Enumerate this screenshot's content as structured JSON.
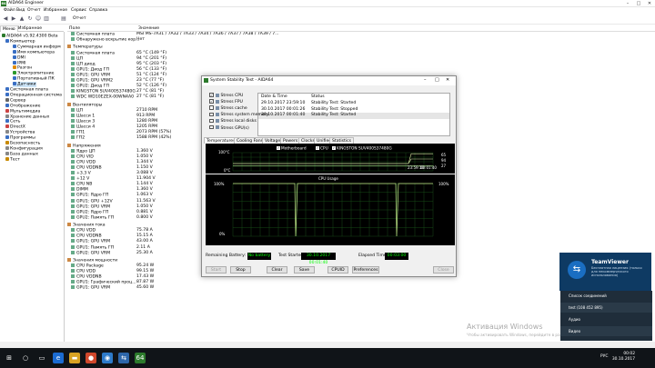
{
  "window": {
    "title": "AIDA64 Engineer",
    "icon_label": "64"
  },
  "menu": [
    "Файл",
    "Вид",
    "Отчет",
    "Избранное",
    "Сервис",
    "Справка"
  ],
  "toolbar": {
    "report_label": "Отчет"
  },
  "left_tabs": [
    "Меню",
    "Избранное"
  ],
  "tree": [
    {
      "label": "AIDA64 v5.92.4300 Beta",
      "indent": 0,
      "color": "#2c7a2c"
    },
    {
      "label": "Компьютер",
      "indent": 1,
      "color": "#3a6fc4"
    },
    {
      "label": "Суммарная информ",
      "indent": 3,
      "color": "#3a6fc4"
    },
    {
      "label": "Имя компьютера",
      "indent": 3,
      "color": "#3a6fc4"
    },
    {
      "label": "DMI",
      "indent": 3,
      "color": "#3a6fc4"
    },
    {
      "label": "IPMI",
      "indent": 3,
      "color": "#3a6fc4"
    },
    {
      "label": "Разгон",
      "indent": 3,
      "color": "#e08a00"
    },
    {
      "label": "Электропитание",
      "indent": 3,
      "color": "#2c9a2c"
    },
    {
      "label": "Портативный ПК",
      "indent": 3,
      "color": "#3a6fc4"
    },
    {
      "label": "Датчики",
      "indent": 3,
      "color": "#3a6fc4",
      "selected": true
    },
    {
      "label": "Системная плата",
      "indent": 1,
      "color": "#3a6fc4"
    },
    {
      "label": "Операционная система",
      "indent": 1,
      "color": "#3a6fc4"
    },
    {
      "label": "Сервер",
      "indent": 1,
      "color": "#666"
    },
    {
      "label": "Отображение",
      "indent": 1,
      "color": "#3a6fc4"
    },
    {
      "label": "Мультимедиа",
      "indent": 1,
      "color": "#c44"
    },
    {
      "label": "Хранение данных",
      "indent": 1,
      "color": "#888"
    },
    {
      "label": "Сеть",
      "indent": 1,
      "color": "#3a6fc4"
    },
    {
      "label": "DirectX",
      "indent": 1,
      "color": "#c44"
    },
    {
      "label": "Устройства",
      "indent": 1,
      "color": "#888"
    },
    {
      "label": "Программы",
      "indent": 1,
      "color": "#3a6fc4"
    },
    {
      "label": "Безопасность",
      "indent": 1,
      "color": "#c88a00"
    },
    {
      "label": "Конфигурация",
      "indent": 1,
      "color": "#888"
    },
    {
      "label": "База данных",
      "indent": 1,
      "color": "#888"
    },
    {
      "label": "Тест",
      "indent": 1,
      "color": "#c88a00"
    }
  ],
  "list_header": {
    "field": "Поле",
    "value": "Значение"
  },
  "list_rows": [
    {
      "type": "item",
      "field": "Системная плата",
      "value": "MSI MS-7A31 / 7A32 / 7A33 / 7A34 / 7A36 / 7A37 / 7A38 / 7A39 / 7..."
    },
    {
      "type": "item",
      "field": "Обнаружено вскрытие кор...",
      "value": "Нет"
    },
    {
      "type": "blank"
    },
    {
      "type": "group",
      "field": "Температуры"
    },
    {
      "type": "item",
      "field": "Системная плата",
      "value": "65 °C  (149 °F)"
    },
    {
      "type": "item",
      "field": "ЦП",
      "value": "94 °C  (201 °F)"
    },
    {
      "type": "item",
      "field": "ЦП диод",
      "value": "95 °C  (203 °F)"
    },
    {
      "type": "item",
      "field": "GPU1: Диод ГП",
      "value": "56 °C  (133 °F)"
    },
    {
      "type": "item",
      "field": "GPU1: GPU VRM",
      "value": "51 °C  (124 °F)"
    },
    {
      "type": "item",
      "field": "GPU1: GPU VRM2",
      "value": "23 °C  (77 °F)"
    },
    {
      "type": "item",
      "field": "GPU2: Диод ГП",
      "value": "52 °C  (126 °F)"
    },
    {
      "type": "item",
      "field": "KINGSTON SUV400S37480G",
      "value": "27 °C  (81 °F)"
    },
    {
      "type": "item",
      "field": "WDC WD10EZEX-00WN4A0",
      "value": "27 °C  (81 °F)"
    },
    {
      "type": "blank"
    },
    {
      "type": "group",
      "field": "Вентиляторы"
    },
    {
      "type": "item",
      "field": "ЦП",
      "value": "2710 RPM"
    },
    {
      "type": "item",
      "field": "Шасси 1",
      "value": "913 RPM"
    },
    {
      "type": "item",
      "field": "Шасси 3",
      "value": "1280 RPM"
    },
    {
      "type": "item",
      "field": "Шасси 4",
      "value": "1205 RPM"
    },
    {
      "type": "item",
      "field": "ГП1",
      "value": "2073 RPM  (57%)"
    },
    {
      "type": "item",
      "field": "ГП2",
      "value": "1588 RPM  (42%)"
    },
    {
      "type": "blank"
    },
    {
      "type": "group",
      "field": "Напряжения"
    },
    {
      "type": "item",
      "field": "Ядро ЦП",
      "value": "1.360 V"
    },
    {
      "type": "item",
      "field": "CPU VID",
      "value": "1.050 V"
    },
    {
      "type": "item",
      "field": "CPU VDD",
      "value": "1.344 V"
    },
    {
      "type": "item",
      "field": "CPU VDDNB",
      "value": "1.150 V"
    },
    {
      "type": "item",
      "field": "+3.3 V",
      "value": "3.088 V"
    },
    {
      "type": "item",
      "field": "+12 V",
      "value": "11.904 V"
    },
    {
      "type": "item",
      "field": "CPU NB",
      "value": "1.144 V"
    },
    {
      "type": "item",
      "field": "DIMM",
      "value": "1.360 V"
    },
    {
      "type": "item",
      "field": "GPU1: Ядро ГП",
      "value": "1.063 V"
    },
    {
      "type": "item",
      "field": "GPU1: GPU +12V",
      "value": "11.563 V"
    },
    {
      "type": "item",
      "field": "GPU1: GPU VRM",
      "value": "1.050 V"
    },
    {
      "type": "item",
      "field": "GPU2: Ядро ГП",
      "value": "0.881 V"
    },
    {
      "type": "item",
      "field": "GPU2: Память ГП",
      "value": "0.800 V"
    },
    {
      "type": "blank"
    },
    {
      "type": "group",
      "field": "Значения тока"
    },
    {
      "type": "item",
      "field": "CPU VDD",
      "value": "75.78 A"
    },
    {
      "type": "item",
      "field": "CPU VDDNB",
      "value": "15.15 A"
    },
    {
      "type": "item",
      "field": "GPU1: GPU VRM",
      "value": "43.00 A"
    },
    {
      "type": "item",
      "field": "GPU1: Память ГП",
      "value": "2.11 A"
    },
    {
      "type": "item",
      "field": "GPU2: GPU VRM",
      "value": "25.30 A"
    },
    {
      "type": "blank"
    },
    {
      "type": "group",
      "field": "Значения мощности"
    },
    {
      "type": "item",
      "field": "CPU Package",
      "value": "95.24 W"
    },
    {
      "type": "item",
      "field": "CPU VDD",
      "value": "99.15 W"
    },
    {
      "type": "item",
      "field": "CPU VDDNB",
      "value": "17.43 W"
    },
    {
      "type": "item",
      "field": "GPU1: Графический проц...",
      "value": "87.87 W"
    },
    {
      "type": "item",
      "field": "GPU1: GPU VRM",
      "value": "45.60 W"
    }
  ],
  "dialog": {
    "title": "System Stability Test - AIDA64",
    "checks": [
      {
        "label": "Stress CPU",
        "checked": true
      },
      {
        "label": "Stress FPU",
        "checked": true
      },
      {
        "label": "Stress cache",
        "checked": false
      },
      {
        "label": "Stress system memory",
        "checked": false
      },
      {
        "label": "Stress local disks",
        "checked": false
      },
      {
        "label": "Stress GPU(s)",
        "checked": false
      }
    ],
    "table_headers": [
      "Date & Time",
      "Status"
    ],
    "table_rows": [
      {
        "time": "29.10.2017 23:59:10",
        "status": "Stability Test: Started"
      },
      {
        "time": "30.10.2017 00:01:26",
        "status": "Stability Test: Stopped"
      },
      {
        "time": "30.10.2017 00:01:40",
        "status": "Stability Test: Started"
      }
    ],
    "tabs": [
      "Temperatures",
      "Cooling Fans",
      "Voltages",
      "Powers",
      "Clocks",
      "Unified",
      "Statistics"
    ],
    "legend": [
      {
        "label": "Motherboard",
        "checked": true
      },
      {
        "label": "CPU",
        "checked": true
      },
      {
        "label": "KINGSTON SUV400S37480G",
        "checked": true
      }
    ],
    "temp_axis_top": "100°C",
    "temp_axis_bottom": "0°C",
    "temp_times": [
      "23:59:10",
      "00:01:40"
    ],
    "temp_values": [
      "65",
      "94",
      "27"
    ],
    "usage_title": "CPU Usage",
    "usage_axis_top": "100%",
    "usage_axis_bottom": "0%",
    "usage_value": "100%",
    "battery_label": "Remaining Battery:",
    "battery_value": "No battery",
    "started_label": "Test Started:",
    "started_value": "30.10.2017 00:01:40",
    "elapsed_label": "Elapsed Time:",
    "elapsed_value": "00:03:00",
    "buttons": [
      {
        "label": "Start",
        "disabled": true
      },
      {
        "label": "Stop",
        "disabled": false
      },
      {
        "label": "Clear",
        "disabled": false
      },
      {
        "label": "Save",
        "disabled": false
      },
      {
        "label": "CPUID",
        "disabled": false
      },
      {
        "label": "Preferences",
        "disabled": false
      },
      {
        "label": "Close",
        "disabled": true
      }
    ]
  },
  "teamviewer": {
    "title": "TeamViewer",
    "text": "Бесплатная лицензия (только для некоммерческого использования)",
    "panel": [
      "Список соединений",
      "test (108 452 895)",
      "Аудио",
      "Видео"
    ]
  },
  "activation": {
    "title": "Активация Windows",
    "subtitle": "Чтобы активировать Windows, перейдите в раздел \"Параметры\"."
  },
  "tray": {
    "time": "00:02",
    "date": "30.10.2017",
    "lang": "РУС"
  },
  "colors": {
    "green_value": "#00ff00",
    "chart_grid": "#1c5a1c",
    "taskbar": "#101418"
  }
}
